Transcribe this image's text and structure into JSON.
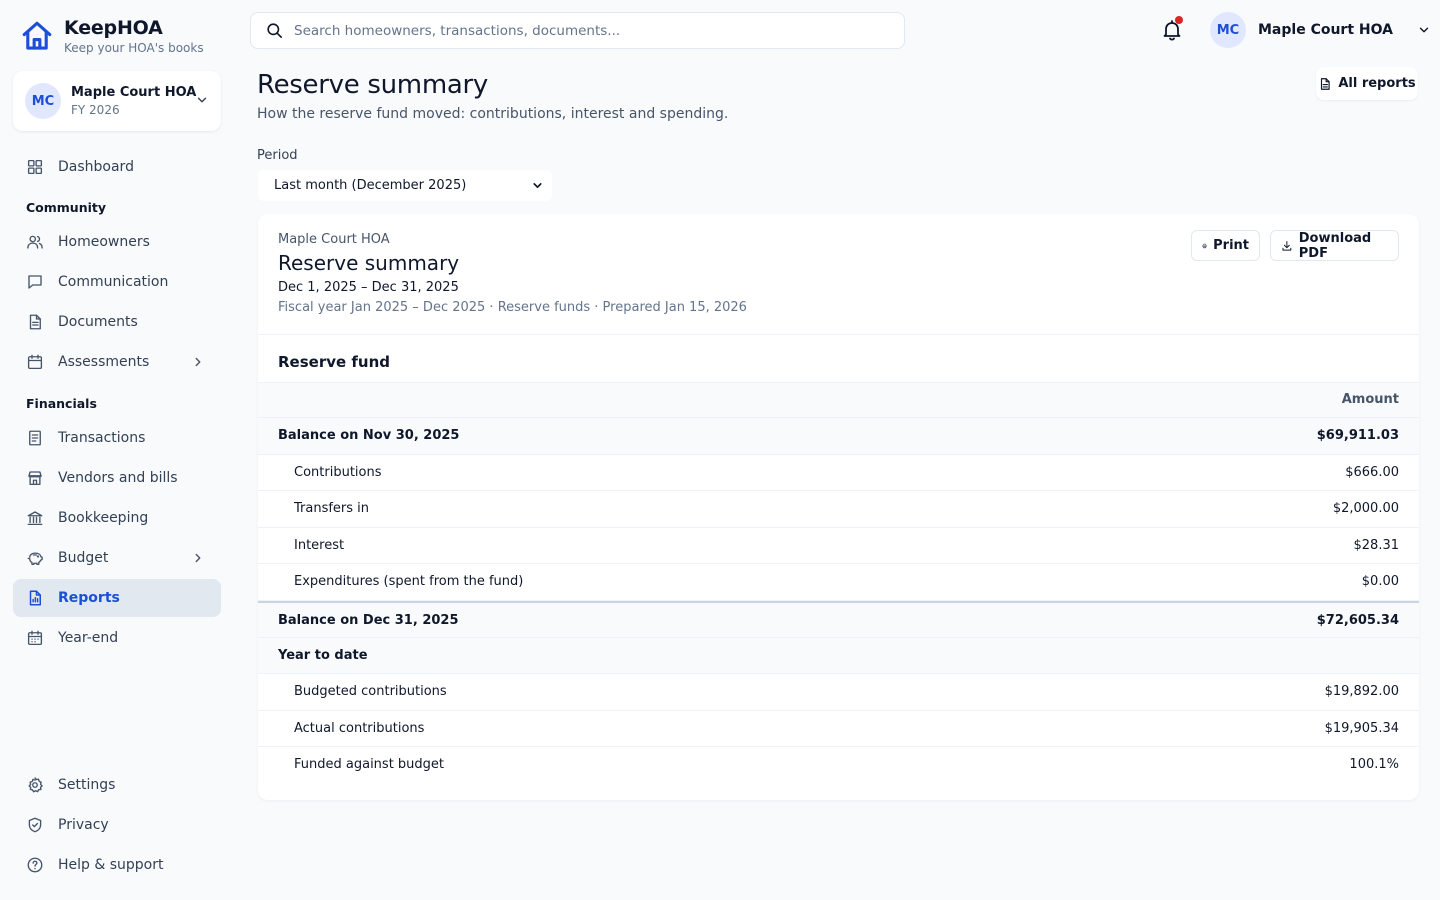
{
  "brand": {
    "name": "KeepHOA",
    "tagline": "Keep your HOA's books"
  },
  "org": {
    "initials": "MC",
    "name": "Maple Court HOA",
    "fiscal_year": "FY 2026"
  },
  "nav": {
    "dashboard": "Dashboard",
    "section_community": "Community",
    "homeowners": "Homeowners",
    "communication": "Communication",
    "documents": "Documents",
    "assessments": "Assessments",
    "section_financials": "Financials",
    "transactions": "Transactions",
    "vendors": "Vendors and bills",
    "bookkeeping": "Bookkeeping",
    "budget": "Budget",
    "reports": "Reports",
    "year_end": "Year-end",
    "settings": "Settings",
    "privacy": "Privacy",
    "help": "Help & support"
  },
  "topbar": {
    "search_placeholder": "Search homeowners, transactions, documents...",
    "user_initials": "MC",
    "user_name": "Maple Court HOA"
  },
  "page": {
    "title": "Reserve summary",
    "subtitle": "How the reserve fund moved: contributions, interest and spending.",
    "all_reports": "All reports",
    "period_label": "Period",
    "period_value": "Last month (December 2025)"
  },
  "report": {
    "org": "Maple Court HOA",
    "title": "Reserve summary",
    "dates": "Dec 1, 2025 – Dec 31, 2025",
    "meta": "Fiscal year Jan 2025 – Dec 2025 · Reserve funds · Prepared Jan 15, 2026",
    "print": "Print",
    "download": "Download PDF",
    "section_title": "Reserve fund",
    "amount_header": "Amount",
    "opening": {
      "label": "Balance on Nov 30, 2025",
      "amount": "$69,911.03"
    },
    "lines": [
      {
        "label": "Contributions",
        "amount": "$666.00"
      },
      {
        "label": "Transfers in",
        "amount": "$2,000.00"
      },
      {
        "label": "Interest",
        "amount": "$28.31"
      },
      {
        "label": "Expenditures (spent from the fund)",
        "amount": "$0.00"
      }
    ],
    "closing": {
      "label": "Balance on Dec 31, 2025",
      "amount": "$72,605.34"
    },
    "ytd_title": "Year to date",
    "ytd": [
      {
        "label": "Budgeted contributions",
        "amount": "$19,892.00"
      },
      {
        "label": "Actual contributions",
        "amount": "$19,905.34"
      },
      {
        "label": "Funded against budget",
        "amount": "100.1%"
      }
    ]
  },
  "colors": {
    "accent": "#1d4ed8",
    "notification": "#dc2626",
    "active_bg": "#e2e8f0"
  }
}
